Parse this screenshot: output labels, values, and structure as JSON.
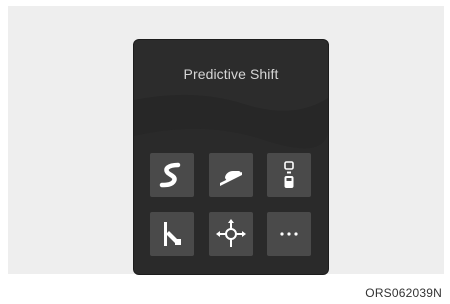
{
  "screen": {
    "title": "Predictive Shift",
    "buttons": [
      {
        "icon": "curve-road-icon"
      },
      {
        "icon": "slope-icon"
      },
      {
        "icon": "vehicle-ahead-icon"
      },
      {
        "icon": "lane-change-icon"
      },
      {
        "icon": "intersection-icon"
      },
      {
        "icon": "more-icon",
        "label": "···"
      }
    ]
  },
  "figure": {
    "reference_code": "ORS062039N"
  },
  "colors": {
    "panel": "#2c2c2c",
    "button": "#4a4a4a",
    "icon": "#ffffff",
    "figure_bg": "#eeeeee"
  }
}
